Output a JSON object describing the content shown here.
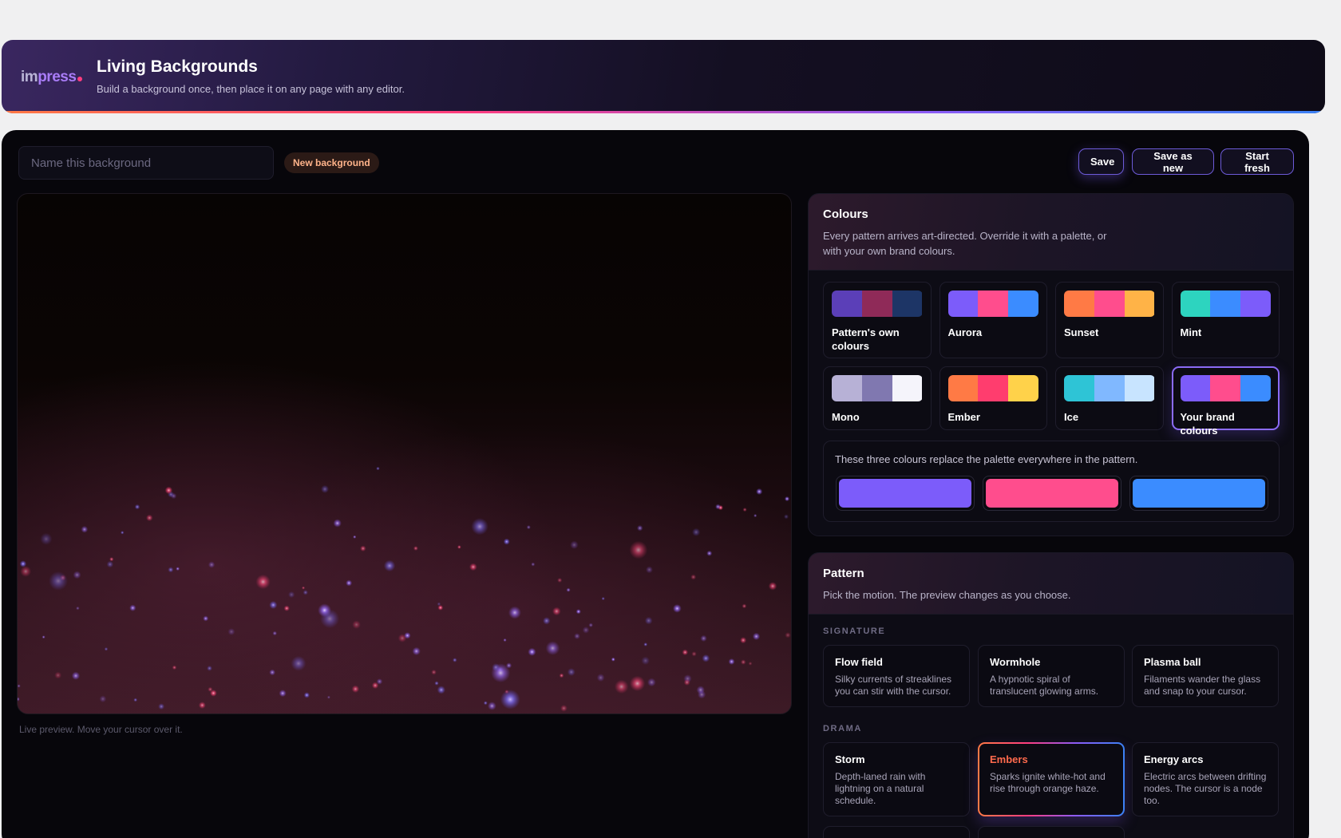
{
  "header": {
    "logo_part1": "im",
    "logo_part2": "press",
    "title": "Living Backgrounds",
    "subtitle": "Build a background once, then place it on any page with any editor."
  },
  "toolbar": {
    "name_placeholder": "Name this background",
    "name_value": "",
    "status_badge": "New background",
    "save_label": "Save",
    "save_as_new_label": "Save as new",
    "start_fresh_label": "Start fresh"
  },
  "preview": {
    "caption": "Live preview. Move your cursor over it."
  },
  "colours": {
    "title": "Colours",
    "description": "Every pattern arrives art-directed. Override it with a palette, or with your own brand colours.",
    "palettes": [
      {
        "name": "Pattern's own colours",
        "swatches": [
          "#5b3fb8",
          "#8f2a58",
          "#1d3566"
        ],
        "selected": false
      },
      {
        "name": "Aurora",
        "swatches": [
          "#7c5cfa",
          "#ff4d8d",
          "#3b8cff"
        ],
        "selected": false
      },
      {
        "name": "Sunset",
        "swatches": [
          "#ff7a45",
          "#ff4d8d",
          "#ffb347"
        ],
        "selected": false
      },
      {
        "name": "Mint",
        "swatches": [
          "#2dd4bf",
          "#3b8cff",
          "#7c5cfa"
        ],
        "selected": false
      },
      {
        "name": "Mono",
        "swatches": [
          "#b7b1d6",
          "#8078b0",
          "#f5f4fb"
        ],
        "selected": false
      },
      {
        "name": "Ember",
        "swatches": [
          "#ff7a45",
          "#ff3d6e",
          "#ffd24a"
        ],
        "selected": false
      },
      {
        "name": "Ice",
        "swatches": [
          "#2ec4d6",
          "#80b8ff",
          "#c8e4ff"
        ],
        "selected": false
      },
      {
        "name": "Your brand colours",
        "swatches": [
          "#7c5cfa",
          "#ff4d8d",
          "#3b8cff"
        ],
        "selected": true
      }
    ],
    "brand_note": "These three colours replace the palette everywhere in the pattern.",
    "brand_colours": [
      "#7c5cfa",
      "#ff4d8d",
      "#3b8cff"
    ]
  },
  "pattern": {
    "title": "Pattern",
    "description": "Pick the motion. The preview changes as you choose.",
    "sections": [
      {
        "label": "SIGNATURE",
        "items": [
          {
            "name": "Flow field",
            "desc": "Silky currents of streaklines you can stir with the cursor.",
            "selected": false
          },
          {
            "name": "Wormhole",
            "desc": "A hypnotic spiral of translucent glowing arms.",
            "selected": false
          },
          {
            "name": "Plasma ball",
            "desc": "Filaments wander the glass and snap to your cursor.",
            "selected": false
          }
        ]
      },
      {
        "label": "DRAMA",
        "items": [
          {
            "name": "Storm",
            "desc": "Depth-laned rain with lightning on a natural schedule.",
            "selected": false
          },
          {
            "name": "Embers",
            "desc": "Sparks ignite white-hot and rise through orange haze.",
            "selected": true
          },
          {
            "name": "Energy arcs",
            "desc": "Electric arcs between drifting nodes. The cursor is a node too.",
            "selected": false
          }
        ]
      }
    ]
  },
  "colors": {
    "accent": "#7c5cfa",
    "pink": "#ff4d8d",
    "blue": "#3b8cff",
    "orange": "#ff7a45"
  }
}
